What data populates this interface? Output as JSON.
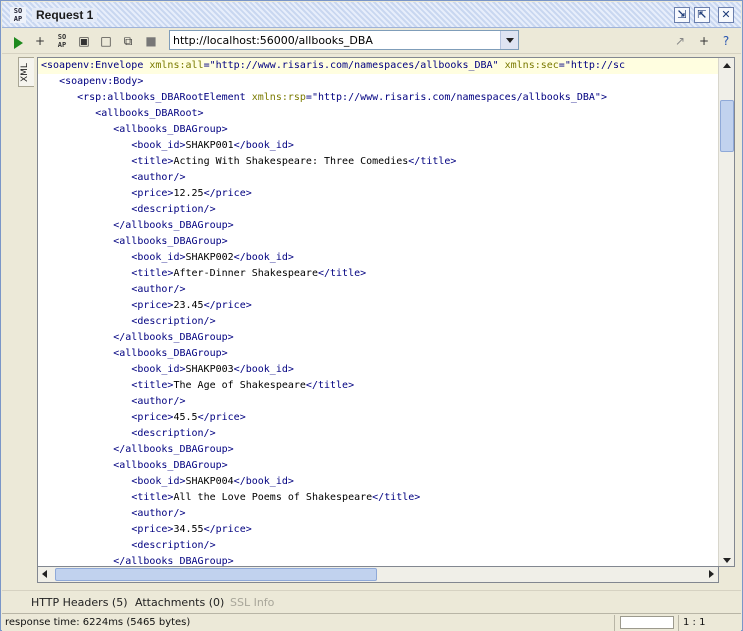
{
  "window": {
    "title": "Request 1",
    "icon": "SO AP"
  },
  "title_buttons": [
    {
      "name": "minimize-panel-icon",
      "glyph": "⇲"
    },
    {
      "name": "detach-panel-icon",
      "glyph": "⇱"
    },
    {
      "name": "close-icon",
      "glyph": "✕"
    }
  ],
  "toolbar": {
    "url": "http://localhost:56000/allbooks_DBA",
    "icons": [
      "run-icon",
      "add-assertion-icon",
      "soap-icon",
      "create-empty-icon",
      "clone-icon",
      "split-icon",
      "stop-icon"
    ],
    "right_icons": [
      "ws-a-icon",
      "add-icon",
      "help-icon"
    ]
  },
  "side_tab": {
    "label": "XML"
  },
  "code_lines": [
    {
      "indent": 0,
      "parts": [
        [
          "tag",
          "<soapenv:Envelope "
        ],
        [
          "attr",
          "xmlns:all"
        ],
        [
          "tag",
          "=\""
        ],
        [
          "val",
          "http://www.risaris.com/namespaces/allbooks_DBA"
        ],
        [
          "tag",
          "\" "
        ],
        [
          "attr",
          "xmlns:sec"
        ],
        [
          "tag",
          "=\"http://sc"
        ]
      ],
      "hl": true
    },
    {
      "indent": 3,
      "parts": [
        [
          "tag",
          "<soapenv:Body>"
        ]
      ]
    },
    {
      "indent": 6,
      "parts": [
        [
          "tag",
          "<rsp:allbooks_DBARootElement "
        ],
        [
          "attr",
          "xmlns:rsp"
        ],
        [
          "tag",
          "=\""
        ],
        [
          "val",
          "http://www.risaris.com/namespaces/allbooks_DBA"
        ],
        [
          "tag",
          "\">"
        ]
      ]
    },
    {
      "indent": 9,
      "parts": [
        [
          "tag",
          "<allbooks_DBARoot>"
        ]
      ]
    },
    {
      "indent": 12,
      "parts": [
        [
          "tag",
          "<allbooks_DBAGroup>"
        ]
      ]
    },
    {
      "indent": 15,
      "parts": [
        [
          "tag",
          "<book_id>"
        ],
        [
          "txt",
          "SHAKP001"
        ],
        [
          "tag",
          "</book_id>"
        ]
      ]
    },
    {
      "indent": 15,
      "parts": [
        [
          "tag",
          "<title>"
        ],
        [
          "txt",
          "Acting With Shakespeare: Three Comedies"
        ],
        [
          "tag",
          "</title>"
        ]
      ]
    },
    {
      "indent": 15,
      "parts": [
        [
          "tag",
          "<author/>"
        ]
      ]
    },
    {
      "indent": 15,
      "parts": [
        [
          "tag",
          "<price>"
        ],
        [
          "txt",
          "12.25"
        ],
        [
          "tag",
          "</price>"
        ]
      ]
    },
    {
      "indent": 15,
      "parts": [
        [
          "tag",
          "<description/>"
        ]
      ]
    },
    {
      "indent": 12,
      "parts": [
        [
          "tag",
          "</allbooks_DBAGroup>"
        ]
      ]
    },
    {
      "indent": 12,
      "parts": [
        [
          "tag",
          "<allbooks_DBAGroup>"
        ]
      ]
    },
    {
      "indent": 15,
      "parts": [
        [
          "tag",
          "<book_id>"
        ],
        [
          "txt",
          "SHAKP002"
        ],
        [
          "tag",
          "</book_id>"
        ]
      ]
    },
    {
      "indent": 15,
      "parts": [
        [
          "tag",
          "<title>"
        ],
        [
          "txt",
          "After-Dinner Shakespeare"
        ],
        [
          "tag",
          "</title>"
        ]
      ]
    },
    {
      "indent": 15,
      "parts": [
        [
          "tag",
          "<author/>"
        ]
      ]
    },
    {
      "indent": 15,
      "parts": [
        [
          "tag",
          "<price>"
        ],
        [
          "txt",
          "23.45"
        ],
        [
          "tag",
          "</price>"
        ]
      ]
    },
    {
      "indent": 15,
      "parts": [
        [
          "tag",
          "<description/>"
        ]
      ]
    },
    {
      "indent": 12,
      "parts": [
        [
          "tag",
          "</allbooks_DBAGroup>"
        ]
      ]
    },
    {
      "indent": 12,
      "parts": [
        [
          "tag",
          "<allbooks_DBAGroup>"
        ]
      ]
    },
    {
      "indent": 15,
      "parts": [
        [
          "tag",
          "<book_id>"
        ],
        [
          "txt",
          "SHAKP003"
        ],
        [
          "tag",
          "</book_id>"
        ]
      ]
    },
    {
      "indent": 15,
      "parts": [
        [
          "tag",
          "<title>"
        ],
        [
          "txt",
          "The Age of Shakespeare"
        ],
        [
          "tag",
          "</title>"
        ]
      ]
    },
    {
      "indent": 15,
      "parts": [
        [
          "tag",
          "<author/>"
        ]
      ]
    },
    {
      "indent": 15,
      "parts": [
        [
          "tag",
          "<price>"
        ],
        [
          "txt",
          "45.5"
        ],
        [
          "tag",
          "</price>"
        ]
      ]
    },
    {
      "indent": 15,
      "parts": [
        [
          "tag",
          "<description/>"
        ]
      ]
    },
    {
      "indent": 12,
      "parts": [
        [
          "tag",
          "</allbooks_DBAGroup>"
        ]
      ]
    },
    {
      "indent": 12,
      "parts": [
        [
          "tag",
          "<allbooks_DBAGroup>"
        ]
      ]
    },
    {
      "indent": 15,
      "parts": [
        [
          "tag",
          "<book_id>"
        ],
        [
          "txt",
          "SHAKP004"
        ],
        [
          "tag",
          "</book_id>"
        ]
      ]
    },
    {
      "indent": 15,
      "parts": [
        [
          "tag",
          "<title>"
        ],
        [
          "txt",
          "All the Love Poems of Shakespeare"
        ],
        [
          "tag",
          "</title>"
        ]
      ]
    },
    {
      "indent": 15,
      "parts": [
        [
          "tag",
          "<author/>"
        ]
      ]
    },
    {
      "indent": 15,
      "parts": [
        [
          "tag",
          "<price>"
        ],
        [
          "txt",
          "34.55"
        ],
        [
          "tag",
          "</price>"
        ]
      ]
    },
    {
      "indent": 15,
      "parts": [
        [
          "tag",
          "<description/>"
        ]
      ]
    },
    {
      "indent": 12,
      "parts": [
        [
          "tag",
          "</allbooks_DBAGroup>"
        ]
      ]
    }
  ],
  "bottom_tabs": [
    {
      "label": "HTTP Headers (5)",
      "disabled": false
    },
    {
      "label": "Attachments (0)",
      "disabled": false
    },
    {
      "label": "SSL Info",
      "disabled": true
    }
  ],
  "status": {
    "text": "response time: 6224ms (5465 bytes)",
    "position": "1 : 1"
  },
  "colors": {
    "tag": "#000080",
    "attr": "#7a7a00",
    "highlight": "#fffee0"
  }
}
